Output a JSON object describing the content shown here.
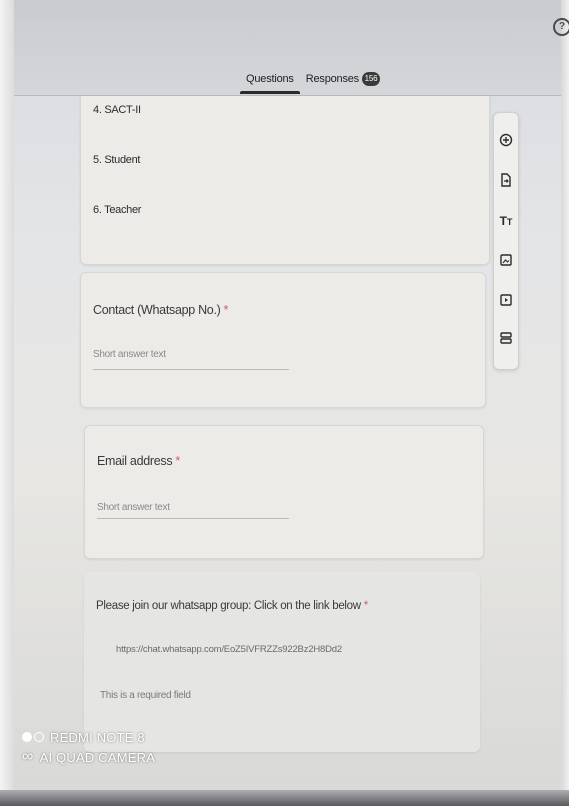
{
  "header": {
    "tabs": [
      {
        "label": "Questions"
      },
      {
        "label": "Responses"
      }
    ],
    "responses_count": "156"
  },
  "options": [
    {
      "label": "4.  SACT-II"
    },
    {
      "label": "5.  Student"
    },
    {
      "label": "6.  Teacher"
    }
  ],
  "contact": {
    "title": "Contact (Whatsapp No.)",
    "required_mark": "*",
    "placeholder": "Short answer text"
  },
  "email": {
    "title": "Email address",
    "required_mark": "*",
    "placeholder": "Short answer text"
  },
  "whatsapp": {
    "title": "Please join our whatsapp group: Click on the link below",
    "required_mark": "*",
    "link": "https://chat.whatsapp.com/EoZ5IVFRZZs922Bz2H8Dd2",
    "required_note": "This is a required field"
  },
  "toolbar": {
    "icons": [
      "add-question-icon",
      "import-questions-icon",
      "add-title-icon",
      "add-image-icon",
      "add-video-icon",
      "add-section-icon"
    ]
  },
  "watermark": {
    "line1": "REDMI NOTE 8",
    "line2": "AI QUAD CAMERA"
  }
}
